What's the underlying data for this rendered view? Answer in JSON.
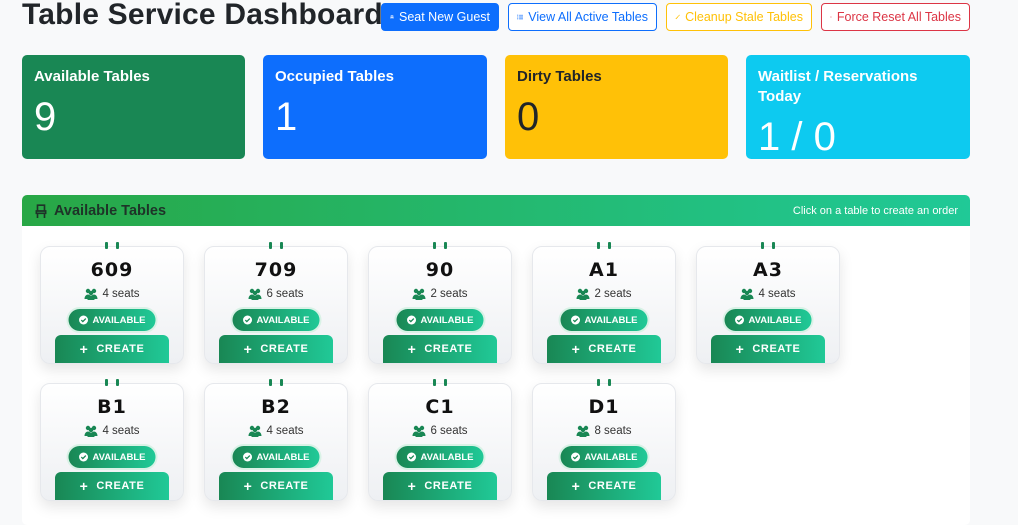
{
  "page": {
    "title": "Table Service Dashboard"
  },
  "toolbar": {
    "seat_new_guest": "Seat New Guest",
    "view_all_active": "View All Active Tables",
    "cleanup_stale": "Cleanup Stale Tables",
    "force_reset": "Force Reset All Tables"
  },
  "stats": [
    {
      "label": "Available Tables",
      "value": "9",
      "color": "#198754",
      "text_color": "#ffffff"
    },
    {
      "label": "Occupied Tables",
      "value": "1",
      "color": "#0d6efd",
      "text_color": "#ffffff"
    },
    {
      "label": "Dirty Tables",
      "value": "0",
      "color": "#ffc107",
      "text_color": "#212529"
    },
    {
      "label": "Waitlist / Reservations Today",
      "value": "1 / 0",
      "color": "#0dcaf0",
      "text_color": "#ffffff"
    }
  ],
  "available_panel": {
    "title": "Available Tables",
    "hint": "Click on a table to create an order"
  },
  "tables": [
    {
      "name": "609",
      "seats": "4 seats",
      "status": "AVAILABLE",
      "action": "CREATE"
    },
    {
      "name": "709",
      "seats": "6 seats",
      "status": "AVAILABLE",
      "action": "CREATE"
    },
    {
      "name": "90",
      "seats": "2 seats",
      "status": "AVAILABLE",
      "action": "CREATE"
    },
    {
      "name": "A1",
      "seats": "2 seats",
      "status": "AVAILABLE",
      "action": "CREATE"
    },
    {
      "name": "A3",
      "seats": "4 seats",
      "status": "AVAILABLE",
      "action": "CREATE"
    },
    {
      "name": "B1",
      "seats": "4 seats",
      "status": "AVAILABLE",
      "action": "CREATE"
    },
    {
      "name": "B2",
      "seats": "4 seats",
      "status": "AVAILABLE",
      "action": "CREATE"
    },
    {
      "name": "C1",
      "seats": "6 seats",
      "status": "AVAILABLE",
      "action": "CREATE"
    },
    {
      "name": "D1",
      "seats": "8 seats",
      "status": "AVAILABLE",
      "action": "CREATE"
    }
  ],
  "icons": {
    "seat_new_guest": "chair-icon",
    "view_all": "list-icon",
    "cleanup": "broom-icon",
    "force_reset": "power-icon",
    "panel": "chair-icon",
    "seats": "users-icon",
    "status": "check-circle-icon",
    "create": "plus-icon"
  }
}
